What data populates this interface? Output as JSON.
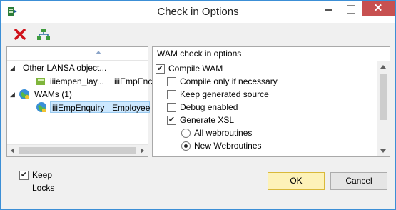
{
  "window": {
    "title": "Check in Options",
    "close_glyph": "✕",
    "icon": "app-icon"
  },
  "toolbar": {
    "items": [
      "delete-red-x-icon",
      "hierarchy-icon"
    ]
  },
  "left_tree": {
    "column_headers": [
      "",
      ""
    ],
    "rows": [
      {
        "label": "Other LANSA object...",
        "expanded": true,
        "icon": "none"
      },
      {
        "label": "iiiempen_lay...",
        "extra": "iiiEmpEnc",
        "icon": "layout-icon"
      },
      {
        "label": "WAMs (1)",
        "expanded": true,
        "icon": "globe-icon"
      },
      {
        "label": "iiiEmpEnquiry",
        "extra": "Employee",
        "icon": "globe-lock-icon",
        "selected": true
      }
    ]
  },
  "right_panel": {
    "header": "WAM check in options",
    "options": [
      {
        "label": "Compile WAM",
        "type": "checkbox",
        "checked": true
      },
      {
        "label": "Compile only if necessary",
        "type": "checkbox",
        "checked": false
      },
      {
        "label": "Keep generated source",
        "type": "checkbox",
        "checked": false
      },
      {
        "label": "Debug enabled",
        "type": "checkbox",
        "checked": false
      },
      {
        "label": "Generate XSL",
        "type": "checkbox",
        "checked": true
      },
      {
        "label": "All webroutines",
        "type": "radio",
        "checked": false
      },
      {
        "label": "New Webroutines",
        "type": "radio",
        "checked": true
      }
    ]
  },
  "footer": {
    "keep_locks_label": "Keep Locks",
    "keep_locks_checked": true,
    "ok_label": "OK",
    "cancel_label": "Cancel"
  },
  "colors": {
    "accent_border": "#3c8fd6",
    "close_button": "#c75050",
    "ok_button": "#fdf2b8",
    "selection": "#cce8ff"
  }
}
